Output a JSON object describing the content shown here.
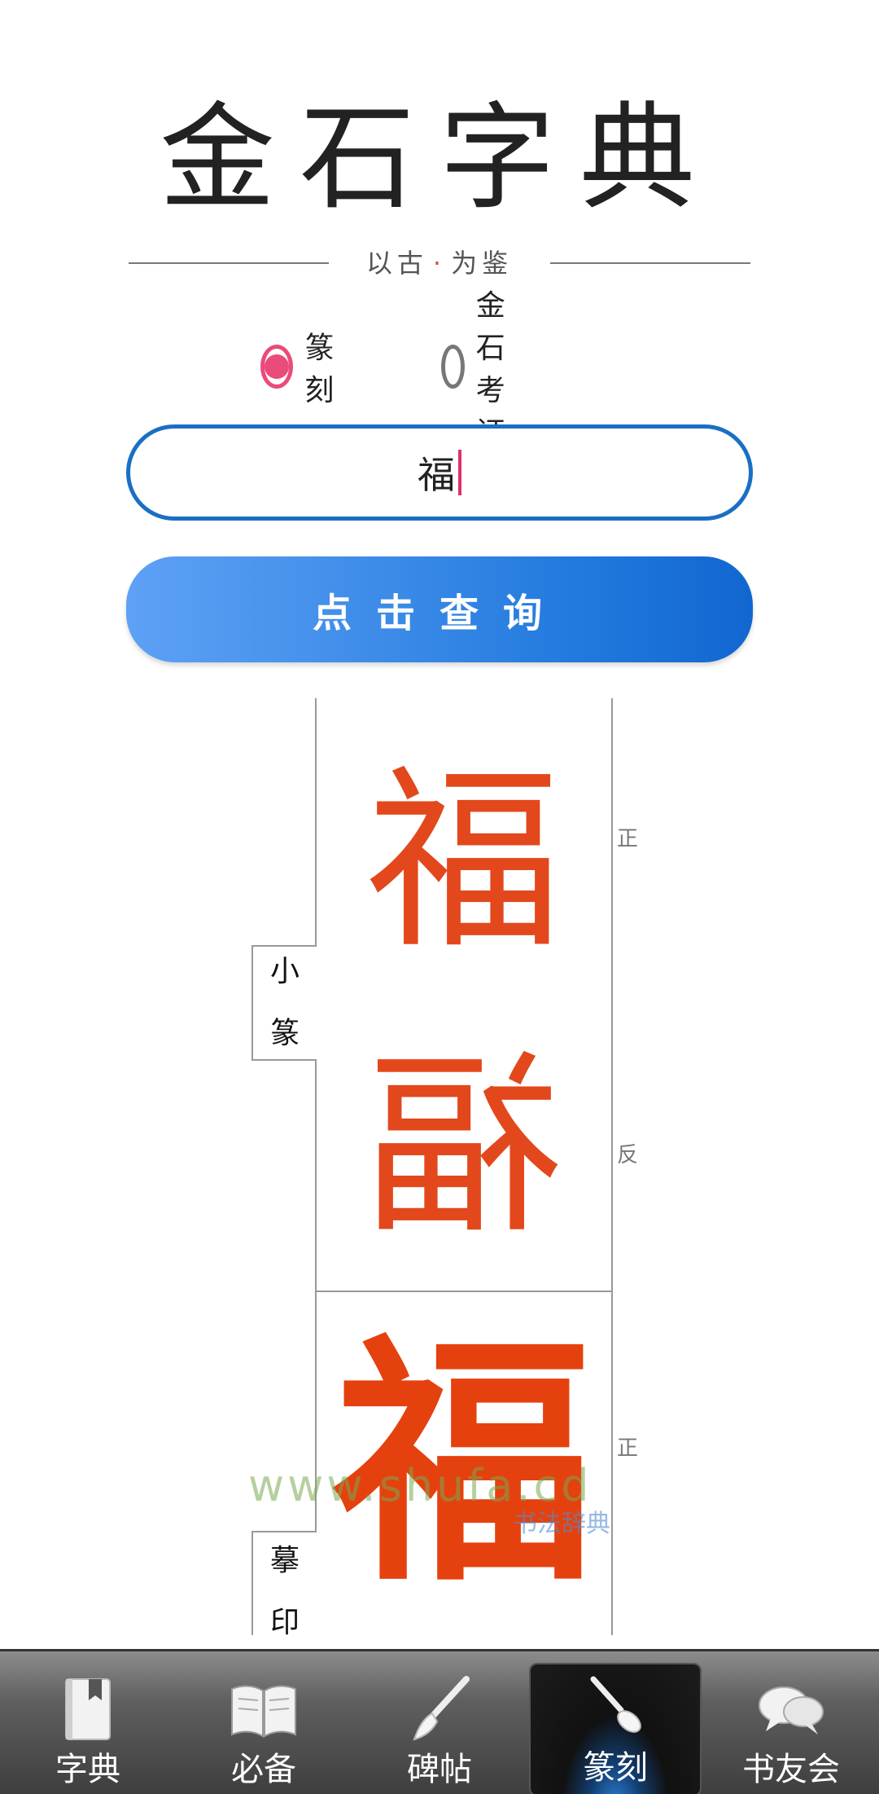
{
  "logo": {
    "title": "金石字典",
    "slogan_left": "以古",
    "slogan_right": "为鉴",
    "slogan_dot": "·"
  },
  "search_mode": {
    "options": [
      {
        "label": "篆刻",
        "checked": true
      },
      {
        "label": "金石考证",
        "checked": false
      }
    ]
  },
  "search": {
    "value": "福"
  },
  "query_button": {
    "label": "点击查询"
  },
  "results": [
    {
      "style_label_1": "小",
      "style_label_2": "篆",
      "glyph": "福",
      "label_front": "正",
      "label_back": "反"
    },
    {
      "style_label_1": "摹",
      "style_label_2": "印",
      "glyph": "福",
      "label_front": "正"
    }
  ],
  "watermark": {
    "url": "www.shufa.cd",
    "text": "书法辞典"
  },
  "tabbar": {
    "items": [
      {
        "label": "字典",
        "icon": "book-bookmark-icon",
        "active": false
      },
      {
        "label": "必备",
        "icon": "open-book-icon",
        "active": false
      },
      {
        "label": "碑帖",
        "icon": "brush-icon",
        "active": false
      },
      {
        "label": "篆刻",
        "icon": "carving-knife-icon",
        "active": true
      },
      {
        "label": "书友会",
        "icon": "chat-bubbles-icon",
        "active": false
      }
    ]
  },
  "colors": {
    "accent_blue": "#1a6fc4",
    "radio_pink": "#ea4b7a",
    "seal_red": "#e2481c"
  }
}
